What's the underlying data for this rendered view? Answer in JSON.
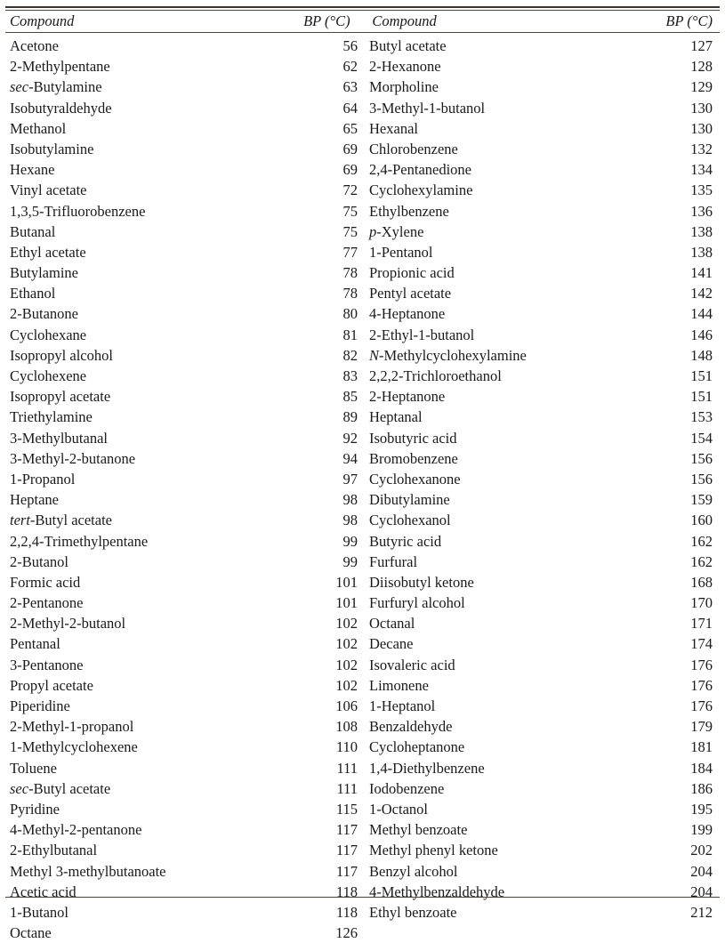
{
  "table": {
    "headers": {
      "compound": "Compound",
      "bp": "BP (°C)"
    },
    "columns": [
      {
        "id": "left",
        "rows": [
          {
            "prefix": "",
            "name": "Acetone",
            "bp": "56"
          },
          {
            "prefix": "",
            "name": "2-Methylpentane",
            "bp": "62"
          },
          {
            "prefix": "sec",
            "name": "-Butylamine",
            "bp": "63"
          },
          {
            "prefix": "",
            "name": "Isobutyraldehyde",
            "bp": "64"
          },
          {
            "prefix": "",
            "name": "Methanol",
            "bp": "65"
          },
          {
            "prefix": "",
            "name": "Isobutylamine",
            "bp": "69"
          },
          {
            "prefix": "",
            "name": "Hexane",
            "bp": "69"
          },
          {
            "prefix": "",
            "name": "Vinyl acetate",
            "bp": "72"
          },
          {
            "prefix": "",
            "name": "1,3,5-Trifluorobenzene",
            "bp": "75"
          },
          {
            "prefix": "",
            "name": "Butanal",
            "bp": "75"
          },
          {
            "prefix": "",
            "name": "Ethyl acetate",
            "bp": "77"
          },
          {
            "prefix": "",
            "name": "Butylamine",
            "bp": "78"
          },
          {
            "prefix": "",
            "name": "Ethanol",
            "bp": "78"
          },
          {
            "prefix": "",
            "name": "2-Butanone",
            "bp": "80"
          },
          {
            "prefix": "",
            "name": "Cyclohexane",
            "bp": "81"
          },
          {
            "prefix": "",
            "name": "Isopropyl alcohol",
            "bp": "82"
          },
          {
            "prefix": "",
            "name": "Cyclohexene",
            "bp": "83"
          },
          {
            "prefix": "",
            "name": "Isopropyl acetate",
            "bp": "85"
          },
          {
            "prefix": "",
            "name": "Triethylamine",
            "bp": "89"
          },
          {
            "prefix": "",
            "name": "3-Methylbutanal",
            "bp": "92"
          },
          {
            "prefix": "",
            "name": "3-Methyl-2-butanone",
            "bp": "94"
          },
          {
            "prefix": "",
            "name": "1-Propanol",
            "bp": "97"
          },
          {
            "prefix": "",
            "name": "Heptane",
            "bp": "98"
          },
          {
            "prefix": "tert",
            "name": "-Butyl acetate",
            "bp": "98"
          },
          {
            "prefix": "",
            "name": "2,2,4-Trimethylpentane",
            "bp": "99"
          },
          {
            "prefix": "",
            "name": "2-Butanol",
            "bp": "99"
          },
          {
            "prefix": "",
            "name": "Formic acid",
            "bp": "101"
          },
          {
            "prefix": "",
            "name": "2-Pentanone",
            "bp": "101"
          },
          {
            "prefix": "",
            "name": "2-Methyl-2-butanol",
            "bp": "102"
          },
          {
            "prefix": "",
            "name": "Pentanal",
            "bp": "102"
          },
          {
            "prefix": "",
            "name": "3-Pentanone",
            "bp": "102"
          },
          {
            "prefix": "",
            "name": "Propyl acetate",
            "bp": "102"
          },
          {
            "prefix": "",
            "name": "Piperidine",
            "bp": "106"
          },
          {
            "prefix": "",
            "name": "2-Methyl-1-propanol",
            "bp": "108"
          },
          {
            "prefix": "",
            "name": "1-Methylcyclohexene",
            "bp": "110"
          },
          {
            "prefix": "",
            "name": "Toluene",
            "bp": "111"
          },
          {
            "prefix": "sec",
            "name": "-Butyl acetate",
            "bp": "111"
          },
          {
            "prefix": "",
            "name": "Pyridine",
            "bp": "115"
          },
          {
            "prefix": "",
            "name": "4-Methyl-2-pentanone",
            "bp": "117"
          },
          {
            "prefix": "",
            "name": "2-Ethylbutanal",
            "bp": "117"
          },
          {
            "prefix": "",
            "name": "Methyl 3-methylbutanoate",
            "bp": "117"
          },
          {
            "prefix": "",
            "name": "Acetic acid",
            "bp": "118"
          },
          {
            "prefix": "",
            "name": "1-Butanol",
            "bp": "118"
          },
          {
            "prefix": "",
            "name": "Octane",
            "bp": "126"
          }
        ]
      },
      {
        "id": "right",
        "rows": [
          {
            "prefix": "",
            "name": "Butyl acetate",
            "bp": "127"
          },
          {
            "prefix": "",
            "name": "2-Hexanone",
            "bp": "128"
          },
          {
            "prefix": "",
            "name": "Morpholine",
            "bp": "129"
          },
          {
            "prefix": "",
            "name": "3-Methyl-1-butanol",
            "bp": "130"
          },
          {
            "prefix": "",
            "name": "Hexanal",
            "bp": "130"
          },
          {
            "prefix": "",
            "name": "Chlorobenzene",
            "bp": "132"
          },
          {
            "prefix": "",
            "name": "2,4-Pentanedione",
            "bp": "134"
          },
          {
            "prefix": "",
            "name": "Cyclohexylamine",
            "bp": "135"
          },
          {
            "prefix": "",
            "name": "Ethylbenzene",
            "bp": "136"
          },
          {
            "prefix": "p",
            "name": "-Xylene",
            "bp": "138"
          },
          {
            "prefix": "",
            "name": "1-Pentanol",
            "bp": "138"
          },
          {
            "prefix": "",
            "name": "Propionic acid",
            "bp": "141"
          },
          {
            "prefix": "",
            "name": "Pentyl acetate",
            "bp": "142"
          },
          {
            "prefix": "",
            "name": "4-Heptanone",
            "bp": "144"
          },
          {
            "prefix": "",
            "name": "2-Ethyl-1-butanol",
            "bp": "146"
          },
          {
            "prefix": "N",
            "name": "-Methylcyclohexylamine",
            "bp": "148"
          },
          {
            "prefix": "",
            "name": "2,2,2-Trichloroethanol",
            "bp": "151"
          },
          {
            "prefix": "",
            "name": "2-Heptanone",
            "bp": "151"
          },
          {
            "prefix": "",
            "name": "Heptanal",
            "bp": "153"
          },
          {
            "prefix": "",
            "name": "Isobutyric acid",
            "bp": "154"
          },
          {
            "prefix": "",
            "name": "Bromobenzene",
            "bp": "156"
          },
          {
            "prefix": "",
            "name": "Cyclohexanone",
            "bp": "156"
          },
          {
            "prefix": "",
            "name": "Dibutylamine",
            "bp": "159"
          },
          {
            "prefix": "",
            "name": "Cyclohexanol",
            "bp": "160"
          },
          {
            "prefix": "",
            "name": "Butyric acid",
            "bp": "162"
          },
          {
            "prefix": "",
            "name": "Furfural",
            "bp": "162"
          },
          {
            "prefix": "",
            "name": "Diisobutyl ketone",
            "bp": "168"
          },
          {
            "prefix": "",
            "name": "Furfuryl alcohol",
            "bp": "170"
          },
          {
            "prefix": "",
            "name": "Octanal",
            "bp": "171"
          },
          {
            "prefix": "",
            "name": "Decane",
            "bp": "174"
          },
          {
            "prefix": "",
            "name": "Isovaleric acid",
            "bp": "176"
          },
          {
            "prefix": "",
            "name": "Limonene",
            "bp": "176"
          },
          {
            "prefix": "",
            "name": "1-Heptanol",
            "bp": "176"
          },
          {
            "prefix": "",
            "name": "Benzaldehyde",
            "bp": "179"
          },
          {
            "prefix": "",
            "name": "Cycloheptanone",
            "bp": "181"
          },
          {
            "prefix": "",
            "name": "1,4-Diethylbenzene",
            "bp": "184"
          },
          {
            "prefix": "",
            "name": "Iodobenzene",
            "bp": "186"
          },
          {
            "prefix": "",
            "name": "1-Octanol",
            "bp": "195"
          },
          {
            "prefix": "",
            "name": "Methyl benzoate",
            "bp": "199"
          },
          {
            "prefix": "",
            "name": "Methyl phenyl ketone",
            "bp": "202"
          },
          {
            "prefix": "",
            "name": "Benzyl alcohol",
            "bp": "204"
          },
          {
            "prefix": "",
            "name": "4-Methylbenzaldehyde",
            "bp": "204"
          },
          {
            "prefix": "",
            "name": "Ethyl benzoate",
            "bp": "212"
          }
        ]
      }
    ]
  }
}
